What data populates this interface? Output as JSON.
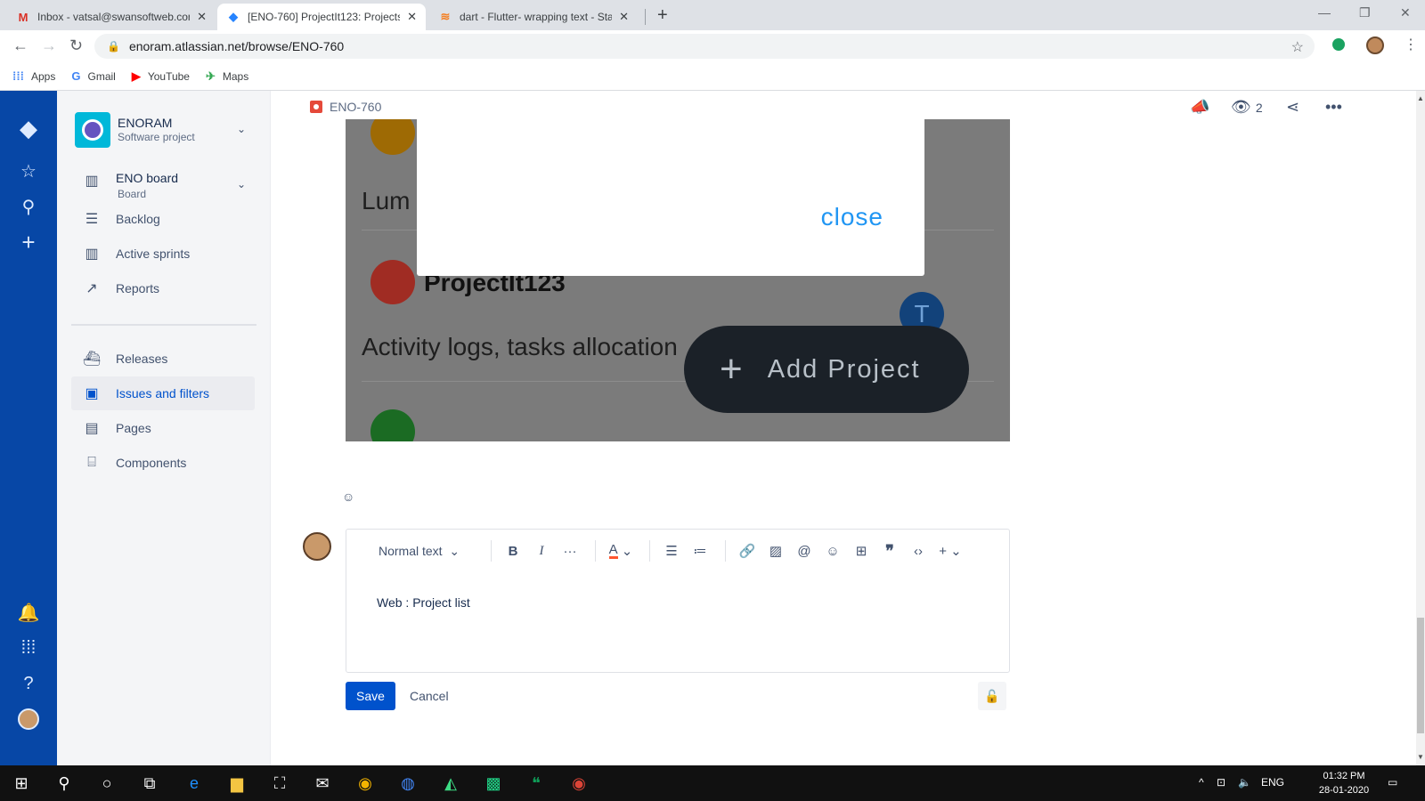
{
  "browser": {
    "tabs": [
      {
        "title": "Inbox - vatsal@swansoftweb.com",
        "icon": "gmail-icon"
      },
      {
        "title": "[ENO-760] ProjectIt123: Projects",
        "icon": "jira-icon"
      },
      {
        "title": "dart - Flutter- wrapping text - Sta",
        "icon": "stackoverflow-icon"
      }
    ],
    "url": "enoram.atlassian.net/browse/ENO-760",
    "bookmarks": [
      {
        "label": "Apps",
        "icon": "apps-grid-icon"
      },
      {
        "label": "Gmail",
        "icon": "google-icon"
      },
      {
        "label": "YouTube",
        "icon": "youtube-icon"
      },
      {
        "label": "Maps",
        "icon": "maps-icon"
      }
    ]
  },
  "sidebar": {
    "project_name": "ENORAM",
    "project_type": "Software project",
    "board_name": "ENO board",
    "board_sub": "Board",
    "items": [
      {
        "label": "Backlog",
        "icon": "backlog-icon"
      },
      {
        "label": "Active sprints",
        "icon": "sprints-icon"
      },
      {
        "label": "Reports",
        "icon": "reports-icon"
      },
      {
        "label": "Releases",
        "icon": "releases-icon"
      },
      {
        "label": "Issues and filters",
        "icon": "issues-icon",
        "selected": true
      },
      {
        "label": "Pages",
        "icon": "pages-icon"
      },
      {
        "label": "Components",
        "icon": "components-icon"
      }
    ]
  },
  "issue": {
    "key": "ENO-760",
    "watchers": "2"
  },
  "attachment": {
    "lum_text": "Lum",
    "close_label": "close",
    "project_title": "ProjectIt123",
    "project_desc": "Activity logs, tasks allocation",
    "avatar_letter": "T",
    "fab_label": "Add Project",
    "fab_plus": "+"
  },
  "editor": {
    "text_style": "Normal text",
    "body": "Web : Project list",
    "save_label": "Save",
    "cancel_label": "Cancel"
  },
  "taskbar": {
    "time": "01:32 PM",
    "date": "28-01-2020",
    "lang": "ENG"
  },
  "colors": {
    "jira_nav": "#0747a6",
    "primary": "#0052cc",
    "taskbar": "#111111"
  }
}
